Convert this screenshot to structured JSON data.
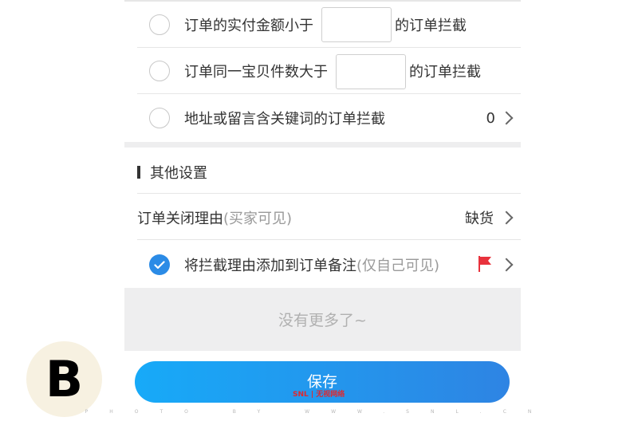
{
  "rules": [
    {
      "prefix": "订单的实付金额小于",
      "suffix": "的订单拦截",
      "value": ""
    },
    {
      "prefix": "订单同一宝贝件数大于",
      "suffix": "的订单拦截",
      "value": ""
    },
    {
      "label": "地址或留言含关键词的订单拦截",
      "count": "0"
    }
  ],
  "other_settings": {
    "title": "其他设置",
    "close_reason": {
      "label": "订单关闭理由",
      "hint": "(买家可见)",
      "value": "缺货"
    },
    "add_note": {
      "label": "将拦截理由添加到订单备注",
      "hint": "(仅自己可见)",
      "checked": true
    }
  },
  "footer_text": "没有更多了~",
  "save_label": "保存",
  "badge_letter": "B",
  "watermark": {
    "brand": "SNL | 无视网络",
    "credit": "PHOTO BY WWW.SNL.CN"
  },
  "colors": {
    "accent": "#2b8be6",
    "flag": "#e8323c",
    "button_start": "#17aaf8",
    "button_end": "#2e84e3"
  }
}
